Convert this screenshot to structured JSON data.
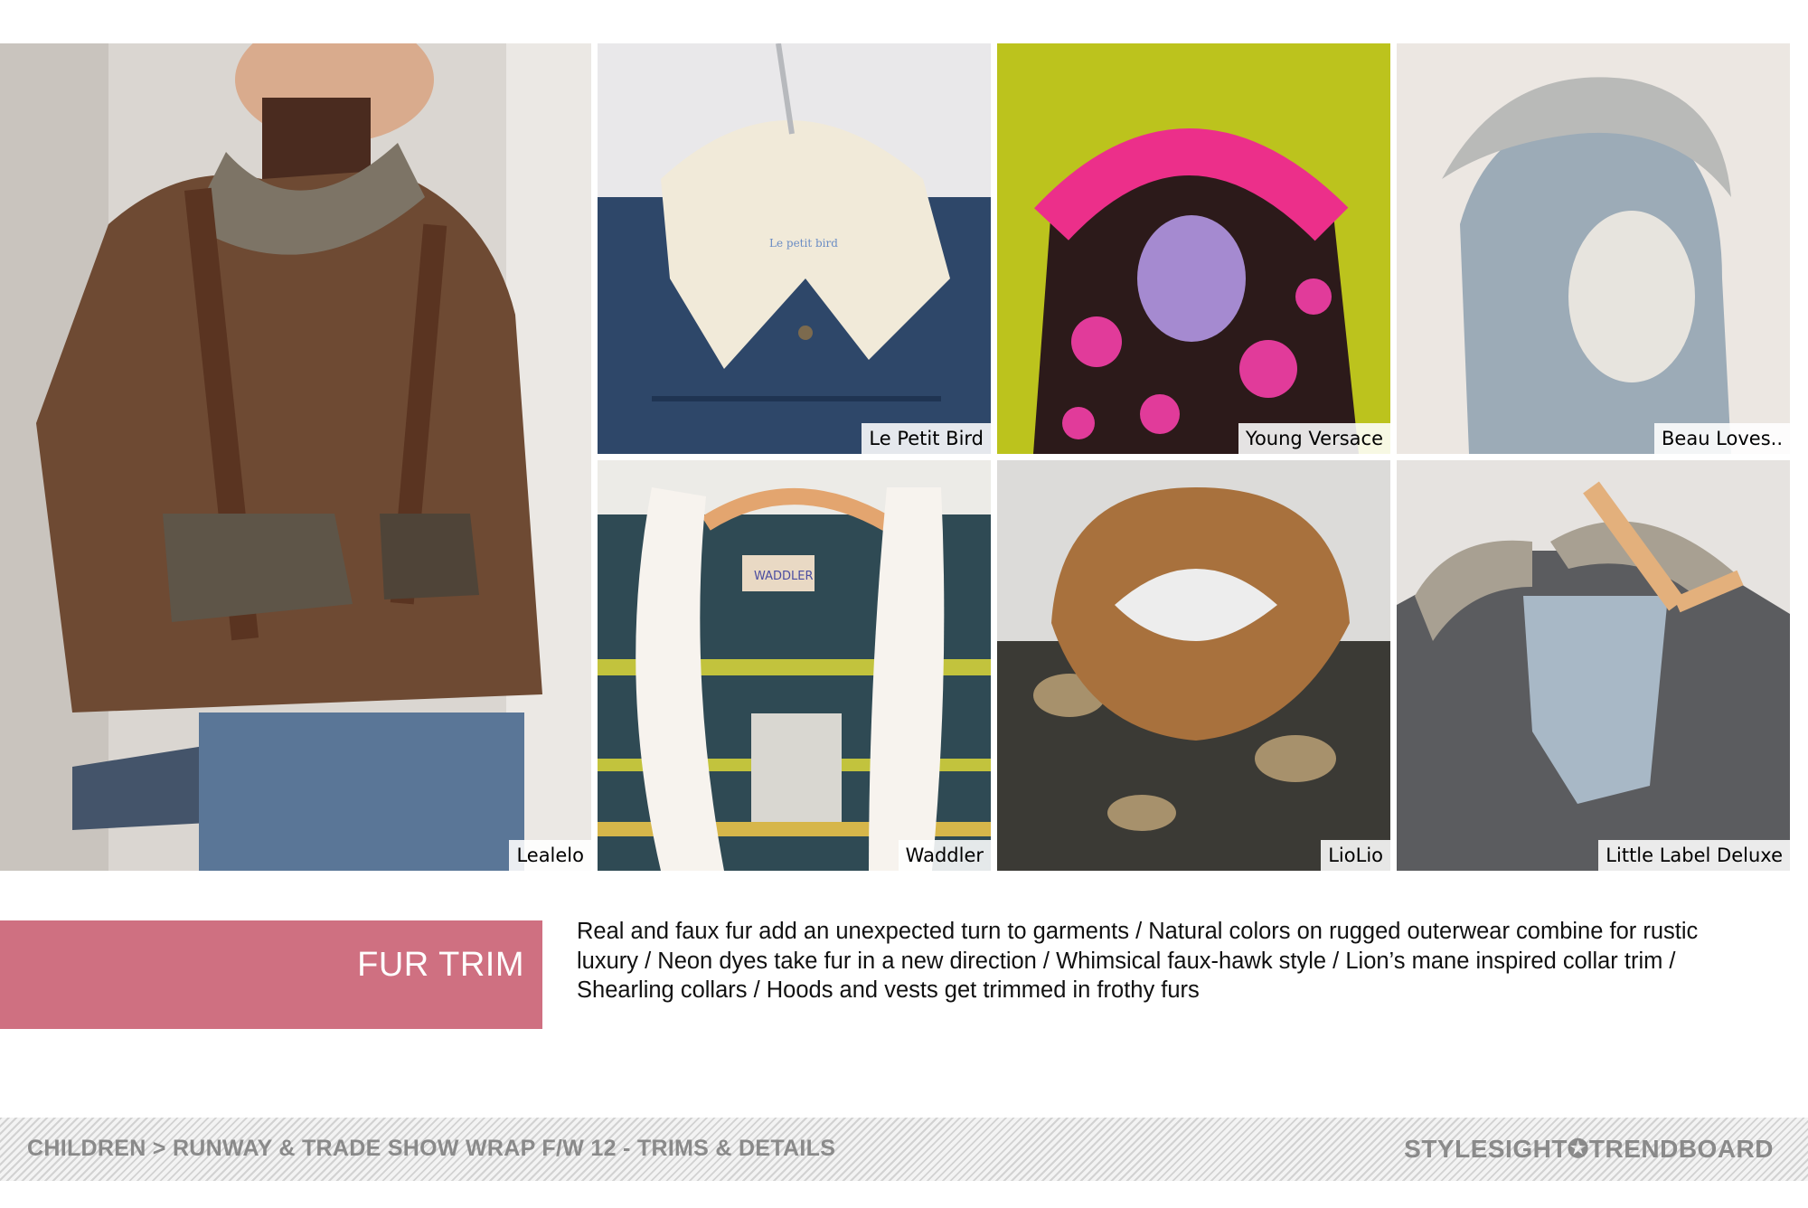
{
  "photos": [
    {
      "brand": "Lealelo"
    },
    {
      "brand": "Le Petit Bird"
    },
    {
      "brand": "Young Versace"
    },
    {
      "brand": "Beau Loves.."
    },
    {
      "brand": "Waddler"
    },
    {
      "brand": "LioLio"
    },
    {
      "brand": "Little Label Deluxe"
    }
  ],
  "garment_labels": {
    "waddler_tag": "WADDLER",
    "petit_bird_tag": "Le petit bird"
  },
  "trend": {
    "title": "FUR TRIM",
    "description": "Real and faux fur add an unexpected turn to garments / Natural colors on rugged outerwear combine for rustic luxury / Neon dyes take fur in a new direction / Whimsical faux-hawk style / Lion’s mane inspired collar trim / Shearling collars / Hoods and vests get trimmed in frothy furs"
  },
  "footer": {
    "breadcrumb": "CHILDREN > RUNWAY & TRADE SHOW WRAP F/W 12 - TRIMS & DETAILS",
    "brand": "STYLESIGHT✪TRENDBOARD"
  },
  "colors": {
    "trend_band": "#cf7081",
    "footer_text": "#8a8a8a"
  }
}
